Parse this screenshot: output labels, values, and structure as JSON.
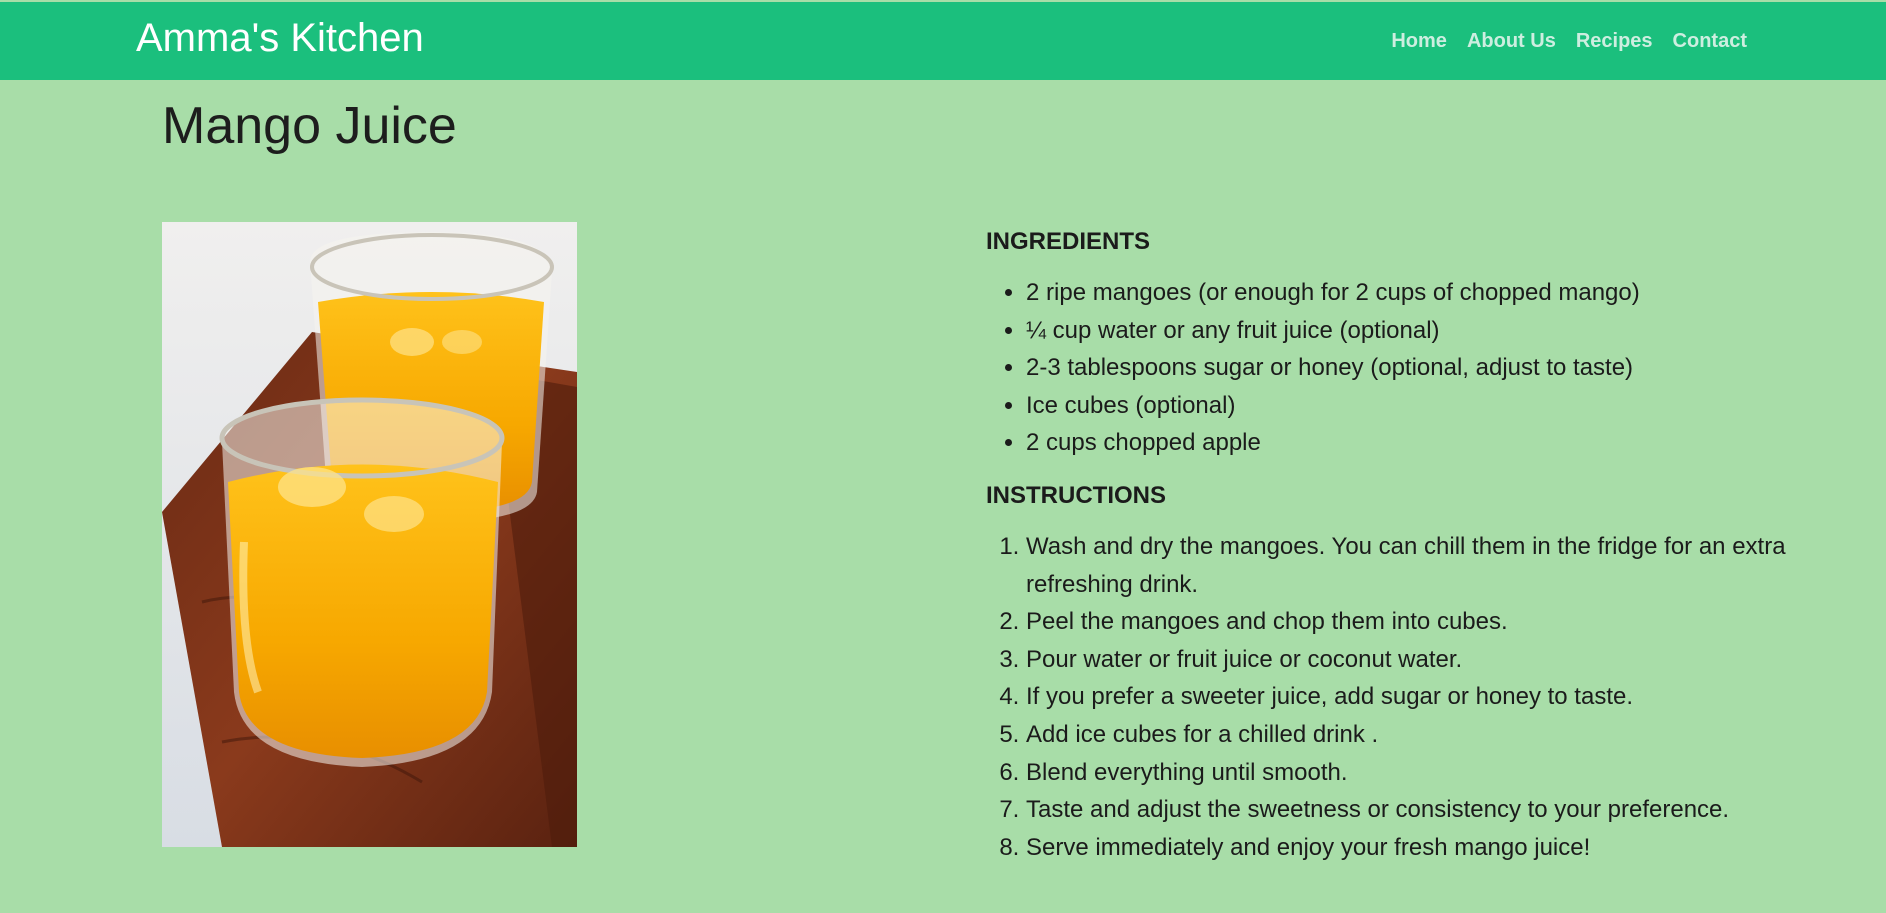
{
  "navbar": {
    "brand": "Amma's Kitchen",
    "links": [
      {
        "label": "Home"
      },
      {
        "label": "About Us"
      },
      {
        "label": "Recipes"
      },
      {
        "label": "Contact"
      }
    ],
    "background": "#1bbf7d"
  },
  "page": {
    "title": "Mango Juice",
    "background": "#a8dda8"
  },
  "recipe": {
    "ingredients_heading": "INGREDIENTS",
    "ingredients": [
      "2 ripe mangoes (or enough for 2 cups of chopped mango)",
      "¼ cup water or any fruit juice (optional)",
      "2-3 tablespoons sugar or honey (optional, adjust to taste)",
      "Ice cubes (optional)",
      "2 cups chopped apple"
    ],
    "instructions_heading": "INSTRUCTIONS",
    "instructions": [
      "Wash and dry the mangoes. You can chill them in the fridge for an extra refreshing drink.",
      "Peel the mangoes and chop them into cubes.",
      "Pour water or fruit juice or coconut water.",
      "If you prefer a sweeter juice, add sugar or honey to taste.",
      "Add ice cubes for a chilled drink .",
      "Blend everything until smooth.",
      "Taste and adjust the sweetness or consistency to your preference.",
      "Serve immediately and enjoy your fresh mango juice!"
    ]
  }
}
